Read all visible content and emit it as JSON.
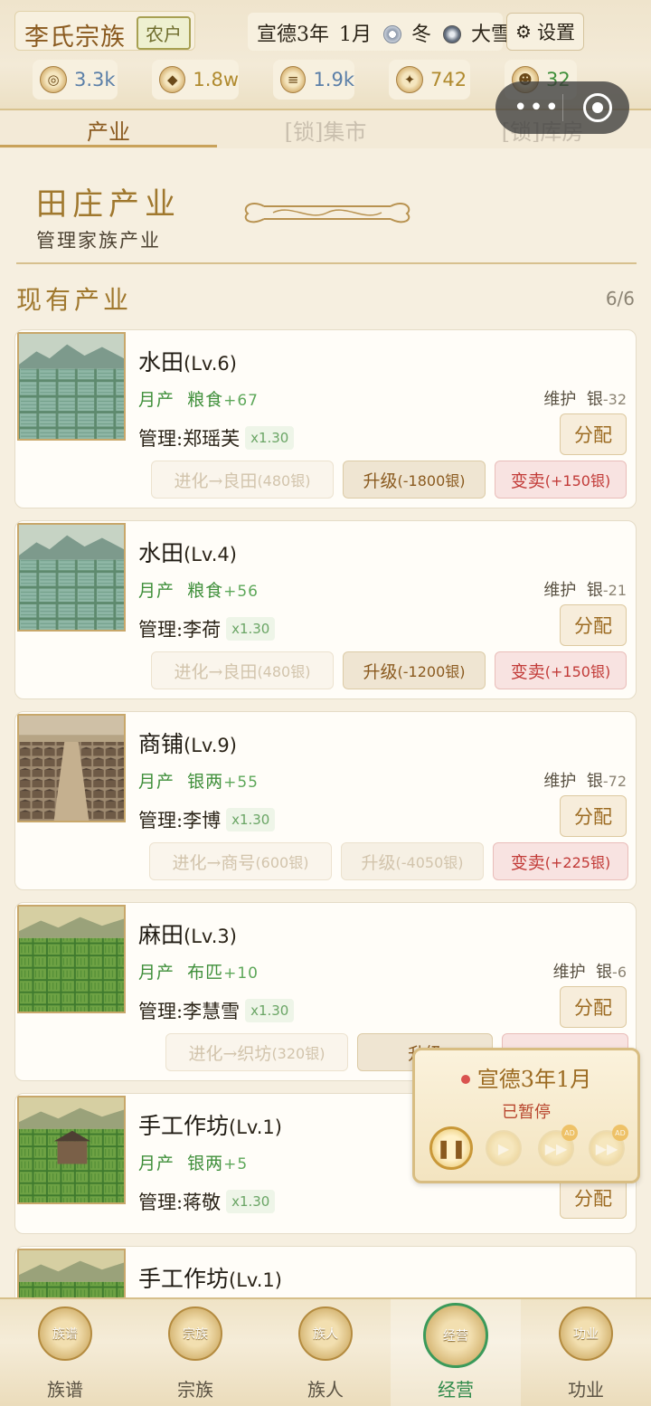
{
  "header": {
    "clan_name": "李氏宗族",
    "rank": "农户",
    "date_era": "宣德3年",
    "date_month": "1月",
    "season": "冬",
    "weather": "大雪",
    "settings_label": "设置",
    "resources": [
      {
        "icon": "silver-ingot-icon",
        "value": "3.3k",
        "color": "#5b7fa8"
      },
      {
        "icon": "grain-sack-icon",
        "value": "1.8w",
        "color": "#b08a2e"
      },
      {
        "icon": "cloth-roll-icon",
        "value": "1.9k",
        "color": "#5b7fa8"
      },
      {
        "icon": "prestige-icon",
        "value": "742",
        "color": "#b08a2e"
      },
      {
        "icon": "population-icon",
        "value": "32",
        "color": "#3f8f3a"
      }
    ]
  },
  "tabs": [
    {
      "label": "产业",
      "active": true
    },
    {
      "label": "[锁]集市",
      "active": false
    },
    {
      "label": "[锁]库房",
      "active": false
    }
  ],
  "banner": {
    "title": "田庄产业",
    "subtitle": "管理家族产业"
  },
  "section": {
    "title": "现有产业",
    "count": "6/6"
  },
  "properties": [
    {
      "name": "水田",
      "level": "(Lv.6)",
      "prod_label": "月产",
      "prod_item": "粮食",
      "prod_value": "+67",
      "maint_label": "维护",
      "maint_item": "银",
      "maint_value": "-32",
      "manager": "管理:郑瑶芙",
      "multiplier": "x1.30",
      "assign": "分配",
      "evolve": "进化→良田",
      "evolve_cost": "(480银)",
      "upgrade": "升级",
      "upgrade_cost": "(-1800银)",
      "sell": "变卖",
      "sell_value": "(+150银)"
    },
    {
      "name": "水田",
      "level": "(Lv.4)",
      "prod_label": "月产",
      "prod_item": "粮食",
      "prod_value": "+56",
      "maint_label": "维护",
      "maint_item": "银",
      "maint_value": "-21",
      "manager": "管理:李荷",
      "multiplier": "x1.30",
      "assign": "分配",
      "evolve": "进化→良田",
      "evolve_cost": "(480银)",
      "upgrade": "升级",
      "upgrade_cost": "(-1200银)",
      "sell": "变卖",
      "sell_value": "(+150银)"
    },
    {
      "name": "商铺",
      "level": "(Lv.9)",
      "prod_label": "月产",
      "prod_item": "银两",
      "prod_value": "+55",
      "maint_label": "维护",
      "maint_item": "银",
      "maint_value": "-72",
      "manager": "管理:李博",
      "multiplier": "x1.30",
      "assign": "分配",
      "evolve": "进化→商号",
      "evolve_cost": "(600银)",
      "upgrade": "升级",
      "upgrade_cost": "(-4050银)",
      "sell": "变卖",
      "sell_value": "(+225银)"
    },
    {
      "name": "麻田",
      "level": "(Lv.3)",
      "prod_label": "月产",
      "prod_item": "布匹",
      "prod_value": "+10",
      "maint_label": "维护",
      "maint_item": "银",
      "maint_value": "-6",
      "manager": "管理:李慧雪",
      "multiplier": "x1.30",
      "assign": "分配",
      "evolve": "进化→织坊",
      "evolve_cost": "(320银)",
      "upgrade": "升级",
      "upgrade_cost": "",
      "sell": "",
      "sell_value": ""
    },
    {
      "name": "手工作坊",
      "level": "(Lv.1)",
      "prod_label": "月产",
      "prod_item": "银两",
      "prod_value": "+5",
      "manager": "管理:蒋敬",
      "multiplier": "x1.30",
      "assign": "分配"
    },
    {
      "name": "手工作坊",
      "level": "(Lv.1)"
    }
  ],
  "time_control": {
    "date": "宣德3年1月",
    "status": "已暂停",
    "ad_label": "AD"
  },
  "nav": [
    {
      "icon_text": "族谱",
      "label": "族谱"
    },
    {
      "icon_text": "宗族",
      "label": "宗族"
    },
    {
      "icon_text": "族人",
      "label": "族人"
    },
    {
      "icon_text": "经营",
      "label": "经营",
      "active": true
    },
    {
      "icon_text": "功业",
      "label": "功业"
    }
  ]
}
